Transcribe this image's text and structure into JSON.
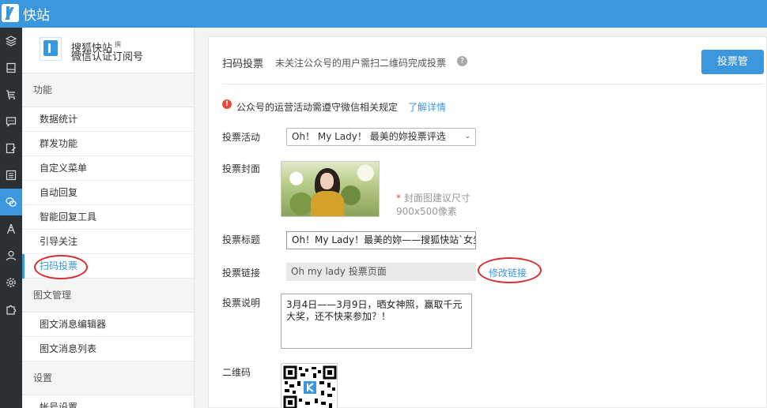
{
  "app": {
    "brand": "快站"
  },
  "account": {
    "name": "搜狐快站",
    "badge": "撰",
    "type": "微信认证订阅号"
  },
  "sidebar": {
    "sections": [
      {
        "label": "功能"
      },
      {
        "label": "图文管理"
      },
      {
        "label": "设置"
      }
    ],
    "function_items": [
      {
        "label": "数据统计"
      },
      {
        "label": "群发功能"
      },
      {
        "label": "自定义菜单"
      },
      {
        "label": "自动回复"
      },
      {
        "label": "智能回复工具"
      },
      {
        "label": "引导关注"
      },
      {
        "label": "扫码投票"
      }
    ],
    "news_items": [
      {
        "label": "图文消息编辑器"
      },
      {
        "label": "图文消息列表"
      }
    ],
    "settings_items": [
      {
        "label": "帐号设置"
      }
    ]
  },
  "rail": {
    "icons": [
      "layers-icon",
      "page-icon",
      "cart-icon",
      "chat-icon",
      "edit-icon",
      "list-icon",
      "wechat-icon",
      "tower-icon",
      "user-icon",
      "gear-icon",
      "puzzle-icon"
    ],
    "active": "wechat-icon"
  },
  "main": {
    "title": "扫码投票",
    "subtitle": "未关注公众号的用户需扫二维码完成投票",
    "help": "?",
    "primary_button": "投票管",
    "notice": {
      "text": "公众号的运营活动需遵守微信相关规定",
      "link": "了解详情"
    },
    "form": {
      "activity_label": "投票活动",
      "activity_value": "Oh！ My Lady！ 最美的妳投票评选",
      "cover_label": "投票封面",
      "cover_hint_line1": "封面图建议尺寸",
      "cover_hint_line2": "900x500像素",
      "title_label": "投票标题",
      "title_value": "Oh！My Lady！最美的妳——搜狐快站`女生",
      "link_label": "投票链接",
      "link_value": "Oh my lady 投票页面",
      "link_change": "修改链接",
      "desc_label": "投票说明",
      "desc_value": "3月4日——3月9日，晒女神照，赢取千元\n大奖，还不快来参加？！",
      "qr_label": "二维码"
    }
  },
  "colors": {
    "accent": "#3a96dd",
    "rail": "#2c3035",
    "alert": "#e44a3f",
    "annotation": "#d62f2f"
  }
}
